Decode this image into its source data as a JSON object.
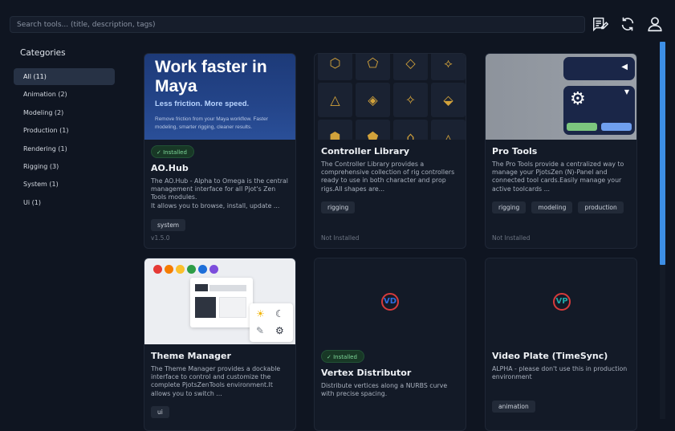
{
  "search": {
    "placeholder": "Search tools... (title, description, tags)"
  },
  "header_icons": [
    "news-icon",
    "refresh-icon",
    "user-icon"
  ],
  "sidebar": {
    "title": "Categories",
    "items": [
      {
        "label": "All (11)",
        "active": true
      },
      {
        "label": "Animation (2)"
      },
      {
        "label": "Modeling (2)"
      },
      {
        "label": "Production (1)"
      },
      {
        "label": "Rendering (1)"
      },
      {
        "label": "Rigging (3)"
      },
      {
        "label": "System (1)"
      },
      {
        "label": "Ui (1)"
      }
    ]
  },
  "cards": [
    {
      "thumb": {
        "headline": "Work faster in Maya",
        "sub": "Less friction. More speed.",
        "small": "Remove friction from your Maya workflow. Faster modeling, smarter rigging, cleaner results."
      },
      "badge": "✓ Installed",
      "title": "AO.Hub",
      "desc": "The AO.Hub - Alpha to Omega is the central management interface for all Pjot's Zen Tools modules.\nIt allows you to browse, install, update ...",
      "tags": [
        "system"
      ],
      "foot": "v1.5.0"
    },
    {
      "title": "Controller Library",
      "desc": "The Controller Library provides a comprehensive collection of rig controllers ready to use in both character and prop rigs.All shapes are...",
      "tags": [
        "rigging"
      ],
      "foot": "Not Installed"
    },
    {
      "title": "Pro Tools",
      "desc": "The Pro Tools provide a centralized way to manage your PjotsZen (N)-Panel and connected tool cards.Easily manage your active toolcards ...",
      "tags": [
        "rigging",
        "modeling",
        "production"
      ],
      "foot": "Not Installed"
    },
    {
      "title": "Theme Manager",
      "desc": "The Theme Manager provides a dockable interface to control and customize the complete PjotsZenTools environment.It allows you to switch ...",
      "tags": [
        "ui"
      ]
    },
    {
      "logo": "VD",
      "badge": "✓ Installed",
      "title": "Vertex Distributor",
      "desc": "Distribute vertices along a NURBS curve with precise spacing.",
      "tags": []
    },
    {
      "logo": "VP",
      "title": "Video Plate (TimeSync)",
      "desc": "ALPHA - please don't use this in production environment",
      "tags": [
        "animation"
      ]
    }
  ],
  "colors": {
    "accent": "#3d8fe6",
    "installed": "#7fd99a",
    "gold": "#d2a23b"
  }
}
